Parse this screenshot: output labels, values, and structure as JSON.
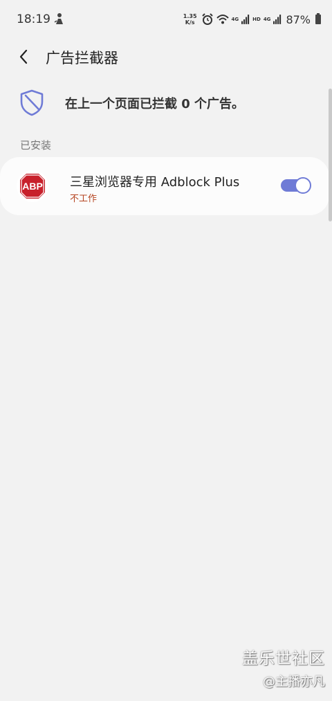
{
  "status_bar": {
    "time": "18:19",
    "net_speed_value": "1.35",
    "net_speed_unit": "K/s",
    "hd_label": "HD",
    "signal_label_1": "4G",
    "signal_label_2": "4G",
    "battery_percent": "87%",
    "icons": [
      "person-icon",
      "alarm-icon",
      "wifi-icon",
      "signal-icon",
      "battery-icon"
    ]
  },
  "header": {
    "title": "广告拦截器"
  },
  "blocked_info": {
    "text": "在上一个页面已拦截 0 个广告。"
  },
  "installed_section": {
    "title": "已安装",
    "items": [
      {
        "name": "三星浏览器专用 Adblock Plus",
        "status": "不工作",
        "logo_text": "ABP",
        "enabled": true
      }
    ]
  },
  "watermark": {
    "title": "盖乐世社区",
    "user": "@主播亦凡"
  },
  "colors": {
    "accent": "#6f7bd6",
    "status_error": "#b5431f",
    "background": "#f2f2f2",
    "card": "#fcfcfc",
    "abp_red": "#c8202b"
  }
}
